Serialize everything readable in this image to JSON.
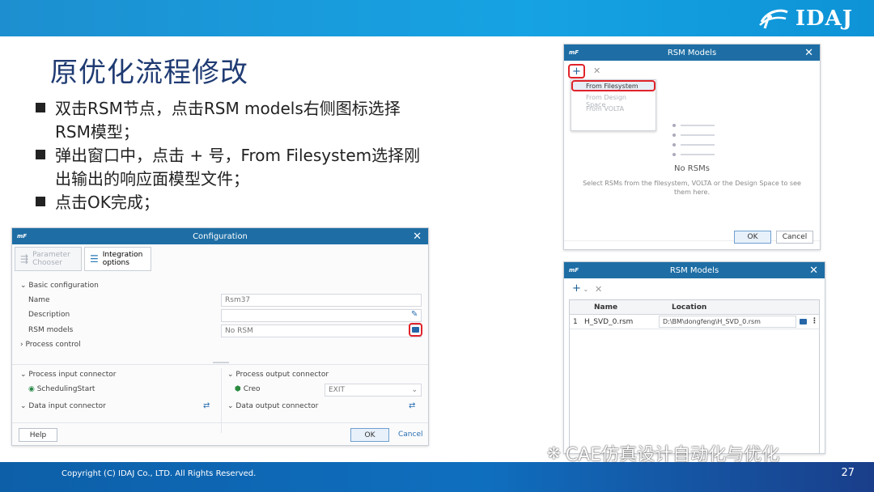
{
  "slide": {
    "title": "原优化流程修改",
    "bullets": [
      {
        "line1": "双击RSM节点，点击RSM models右侧图标选择",
        "line2": "RSM模型；"
      },
      {
        "line1": "弹出窗口中，点击 + 号，From Filesystem选择刚",
        "line2": "出输出的响应面模型文件；"
      },
      {
        "line1": "点击OK完成；",
        "line2": ""
      }
    ],
    "logo_text": "IDAJ",
    "copyright": "Copyright (C)  IDAJ Co., LTD. All Rights Reserved.",
    "page_number": "27",
    "watermark": "CAE仿真设计自动化与优化"
  },
  "config": {
    "title": "Configuration",
    "brand": "mF",
    "toolbar": {
      "param_chooser": [
        "Parameter",
        "Chooser"
      ],
      "integration": [
        "Integration",
        "options"
      ]
    },
    "basic_header": "Basic configuration",
    "name_label": "Name",
    "name_value": "Rsm37",
    "description_label": "Description",
    "description_value": "",
    "rsm_label": "RSM models",
    "rsm_value": "No RSM",
    "process_control": "Process control",
    "input_connector_header": "Process input connector",
    "input_connector_value": "SchedulingStart",
    "output_connector_header": "Process output connector",
    "output_connector_value": "Creo",
    "output_select_value": "EXIT",
    "data_input": "Data input connector",
    "data_output": "Data output connector",
    "help": "Help",
    "ok": "OK",
    "cancel": "Cancel"
  },
  "rsm1": {
    "title": "RSM Models",
    "brand": "mF",
    "menu": [
      "From Filesystem",
      "From Design Space",
      "From VOLTA"
    ],
    "empty_title": "No RSMs",
    "empty_desc": "Select RSMs from the filesystem, VOLTA or the Design Space to see them here.",
    "ok": "OK",
    "cancel": "Cancel"
  },
  "rsm2": {
    "title": "RSM Models",
    "brand": "mF",
    "columns": [
      "Name",
      "Location"
    ],
    "rows": [
      {
        "index": "1",
        "name": "H_SVD_0.rsm",
        "location": "D:\\BM\\dongfeng\\H_SVD_0.rsm"
      }
    ]
  },
  "colors": {
    "banner": "#16a3e3",
    "title": "#1f3b73",
    "window_title": "#1e6ea5",
    "highlight": "#e0242a"
  }
}
